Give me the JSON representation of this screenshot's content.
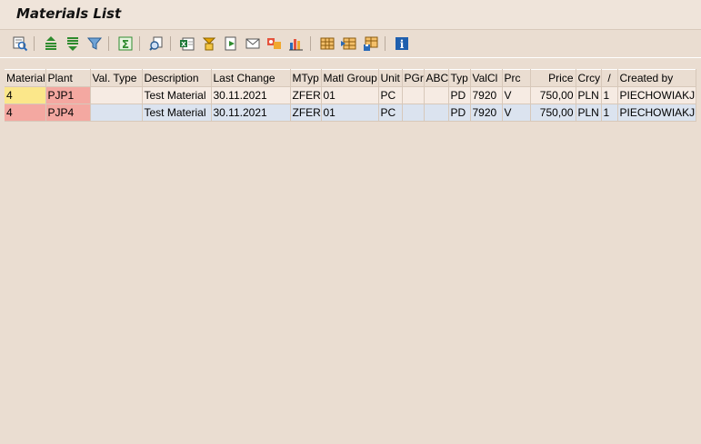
{
  "window": {
    "title": "Materials List"
  },
  "toolbar": {
    "buttons": [
      {
        "name": "details-icon",
        "tooltip": "Details"
      },
      {
        "name": "sort-ascending-icon",
        "tooltip": "Sort in Ascending Order"
      },
      {
        "name": "sort-descending-icon",
        "tooltip": "Sort in Descending Order"
      },
      {
        "name": "filter-icon",
        "tooltip": "Set Filter"
      },
      {
        "name": "total-icon",
        "tooltip": "Total"
      },
      {
        "name": "print-preview-icon",
        "tooltip": "Print Preview"
      },
      {
        "name": "export-spreadsheet-icon",
        "tooltip": "Spreadsheet"
      },
      {
        "name": "word-processing-icon",
        "tooltip": "Word Processing"
      },
      {
        "name": "local-file-icon",
        "tooltip": "Local File"
      },
      {
        "name": "send-icon",
        "tooltip": "Send"
      },
      {
        "name": "abc-analysis-icon",
        "tooltip": "ABC Analysis"
      },
      {
        "name": "graphic-icon",
        "tooltip": "Graphic"
      },
      {
        "name": "change-layout-icon",
        "tooltip": "Change Layout"
      },
      {
        "name": "select-layout-icon",
        "tooltip": "Select Layout"
      },
      {
        "name": "save-layout-icon",
        "tooltip": "Save Layout"
      },
      {
        "name": "information-icon",
        "tooltip": "Information"
      }
    ]
  },
  "grid": {
    "columns": [
      "Material",
      "Plant",
      "Val. Type",
      "Description",
      "Last Change",
      "MTyp",
      "Matl Group",
      "Unit",
      "PGr",
      "ABC",
      "Typ",
      "ValCl",
      "Prc",
      "Price",
      "Crcy",
      "/",
      "Created by"
    ],
    "rows": [
      [
        "4",
        "PJP1",
        "",
        "Test Material",
        "30.11.2021",
        "ZFER",
        "01",
        "PC",
        "",
        "",
        "PD",
        "7920",
        "V",
        "750,00",
        "PLN",
        "1",
        "PIECHOWIAKJ"
      ],
      [
        "4",
        "PJP4",
        "",
        "Test Material",
        "30.11.2021",
        "ZFER",
        "01",
        "PC",
        "",
        "",
        "PD",
        "7920",
        "V",
        "750,00",
        "PLN",
        "1",
        "PIECHOWIAKJ"
      ]
    ]
  },
  "colors": {
    "background": "#eaddd1",
    "row_selected": "#dbe3ef",
    "key_material": "#fbe78a",
    "key_plant": "#f4a8a1"
  }
}
